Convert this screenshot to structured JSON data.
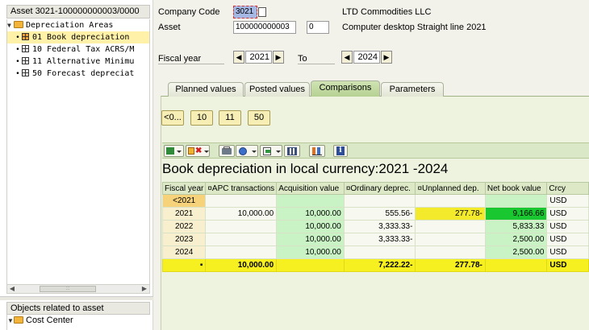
{
  "tree": {
    "header": "Asset 3021-100000000003/0000",
    "root_label": "Depreciation Areas",
    "areas": [
      {
        "label": "01 Book depreciation",
        "selected": true
      },
      {
        "label": "10 Federal Tax ACRS/M",
        "selected": false
      },
      {
        "label": "11 Alternative Minimu",
        "selected": false
      },
      {
        "label": "50 Forecast depreciat",
        "selected": false
      }
    ]
  },
  "objects": {
    "header": "Objects related to asset",
    "items": [
      "Cost Center"
    ]
  },
  "header": {
    "company_code_label": "Company Code",
    "company_code_value": "3021",
    "company_name": "LTD Commodities LLC",
    "asset_label": "Asset",
    "asset_value": "100000000003",
    "subnumber_value": "0",
    "asset_description": "Computer desktop  Straight line 2021",
    "fiscal_year_label": "Fiscal year",
    "fiscal_year_from": "2021",
    "to_label": "To",
    "fiscal_year_to": "2024"
  },
  "tabs": [
    {
      "label": "Planned values",
      "active": false
    },
    {
      "label": "Posted values",
      "active": false
    },
    {
      "label": "Comparisons",
      "active": true
    },
    {
      "label": "Parameters",
      "active": false
    }
  ],
  "year_buttons": [
    "<0...",
    "10",
    "11",
    "50"
  ],
  "toolbar_icons": [
    "excel-export-icon",
    "delete-filter-icon",
    "print-icon",
    "view-icon",
    "export-icon",
    "layout-icon",
    "chart-icon",
    "info-icon"
  ],
  "report": {
    "title": "Book depreciation in local currency:2021 -2024",
    "columns": [
      "Fiscal year",
      "¤APC transactions",
      "Acquisition value",
      "¤Ordinary deprec.",
      "¤Unplanned dep.",
      "Net book value",
      "Crcy"
    ],
    "rows": [
      {
        "year": "<2021",
        "apc": "",
        "acq": "",
        "ord": "",
        "unpl": "",
        "nbv": "",
        "crcy": "USD"
      },
      {
        "year": "2021",
        "apc": "10,000.00",
        "acq": "10,000.00",
        "ord": "555.56-",
        "unpl": "277.78-",
        "nbv": "9,166.66",
        "crcy": "USD"
      },
      {
        "year": "2022",
        "apc": "",
        "acq": "10,000.00",
        "ord": "3,333.33-",
        "unpl": "",
        "nbv": "5,833.33",
        "crcy": "USD"
      },
      {
        "year": "2023",
        "apc": "",
        "acq": "10,000.00",
        "ord": "3,333.33-",
        "unpl": "",
        "nbv": "2,500.00",
        "crcy": "USD"
      },
      {
        "year": "2024",
        "apc": "",
        "acq": "10,000.00",
        "ord": "",
        "unpl": "",
        "nbv": "2,500.00",
        "crcy": "USD"
      }
    ],
    "total": {
      "apc": "10,000.00",
      "ord": "7,222.22-",
      "unpl": "277.78-",
      "crcy": "USD",
      "marker": "▪"
    }
  }
}
